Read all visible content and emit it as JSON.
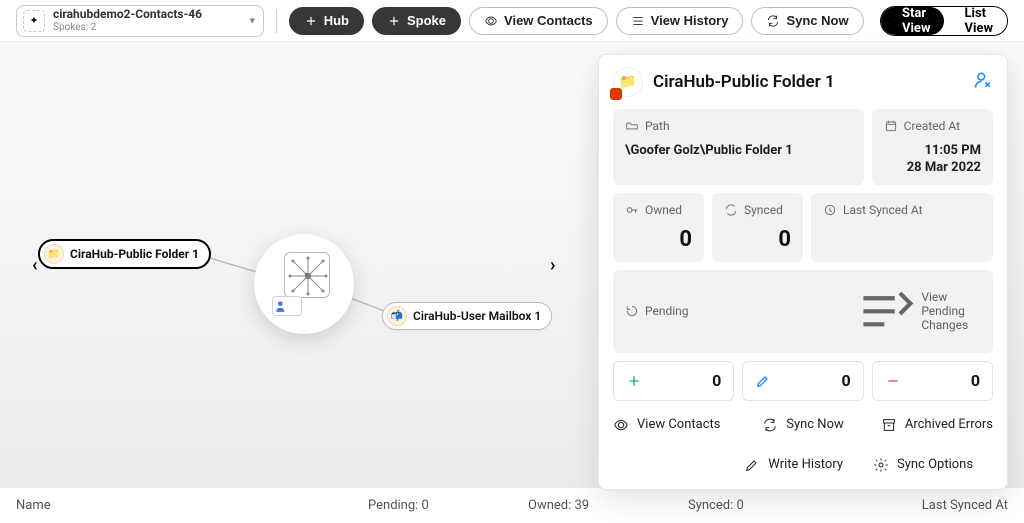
{
  "breadcrumb": {
    "title": "cirahubdemo2-Contacts-46",
    "sub": "Spokes: 2"
  },
  "toolbar": {
    "hub": "Hub",
    "spoke": "Spoke",
    "view_contacts": "View Contacts",
    "view_history": "View History",
    "sync_now": "Sync Now",
    "star_view": "Star View",
    "list_view": "List View"
  },
  "nodes": {
    "hub_folder": "CiraHub-Public Folder 1",
    "user_mailbox": "CiraHub-User Mailbox 1"
  },
  "panel": {
    "title": "CiraHub-Public Folder 1",
    "path_label": "Path",
    "path_value": "\\Goofer Golz\\Public Folder 1",
    "created_label": "Created At",
    "created_time": "11:05 PM",
    "created_date": "28 Mar 2022",
    "owned_label": "Owned",
    "owned_value": "0",
    "synced_label": "Synced",
    "synced_value": "0",
    "last_synced_label": "Last Synced At",
    "pending_label": "Pending",
    "pending_link": "View Pending Changes",
    "mini_add": "0",
    "mini_edit": "0",
    "mini_remove": "0",
    "act_view_contacts": "View Contacts",
    "act_sync_now": "Sync Now",
    "act_archived": "Archived Errors",
    "act_write_history": "Write History",
    "act_sync_options": "Sync Options"
  },
  "footer": {
    "name": "Name",
    "pending": "Pending: 0",
    "owned": "Owned: 39",
    "synced": "Synced: 0",
    "last": "Last Synced At"
  }
}
